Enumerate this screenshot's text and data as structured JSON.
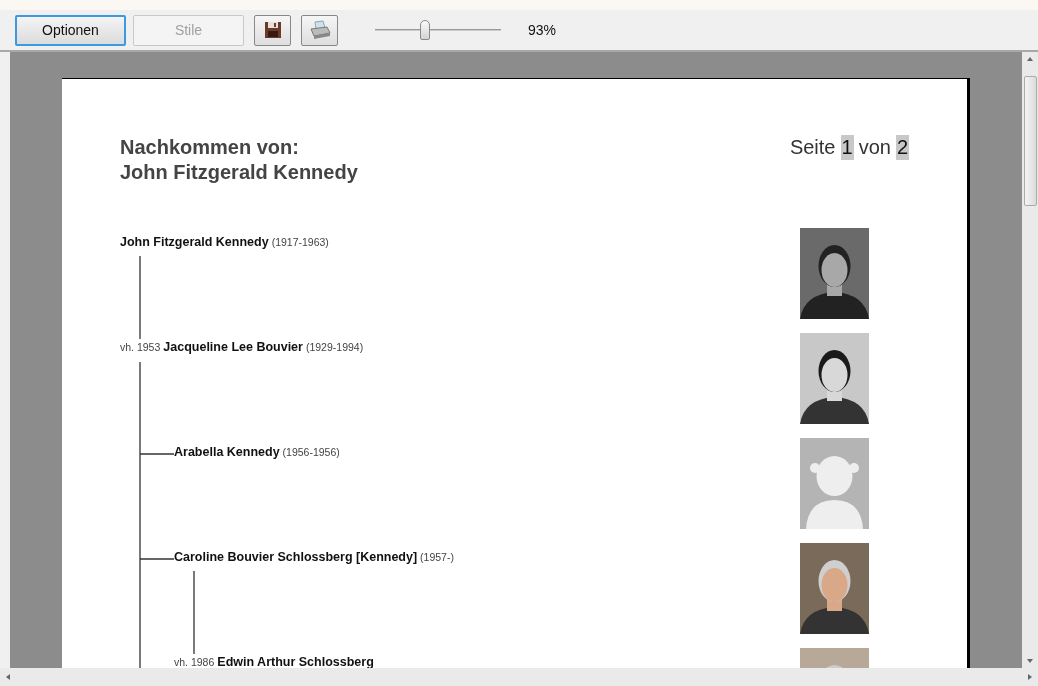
{
  "toolbar": {
    "buttons": [
      {
        "label": "Optionen",
        "disabled": false,
        "focused": true
      },
      {
        "label": "Stile",
        "disabled": true,
        "focused": false
      }
    ],
    "zoom": {
      "level": 0.4,
      "reading": "93%"
    }
  },
  "page": {
    "title_lines": [
      "Nachkommen von:",
      "John Fitzgerald Kennedy"
    ],
    "counter": {
      "word": "Seite",
      "current": "1",
      "of": "von",
      "total": "2"
    },
    "tree": {
      "name": "John Fitzgerald Kennedy",
      "dates": "(1917-1963)",
      "photo": {
        "kind": "picture"
      },
      "spouses": [
        {
          "marriage": "vh. 1953",
          "name": "Jacqueline Lee Bouvier",
          "dates": "(1929-1994)",
          "photo": {
            "kind": "picture"
          },
          "more_below": true,
          "children": [
            {
              "name": "Arabella Kennedy",
              "dates": "(1956-1956)",
              "photo": {
                "kind": "placeholder"
              }
            },
            {
              "name": "Caroline Bouvier Schlossberg [Kennedy]",
              "dates": "(1957-)",
              "photo": {
                "kind": "picture"
              },
              "spouses": [
                {
                  "marriage": "vh. 1986",
                  "name": "Edwin Arthur Schlossberg",
                  "photo": {
                    "kind": "picture"
                  },
                  "more_below": true
                }
              ]
            }
          ]
        }
      ]
    }
  }
}
